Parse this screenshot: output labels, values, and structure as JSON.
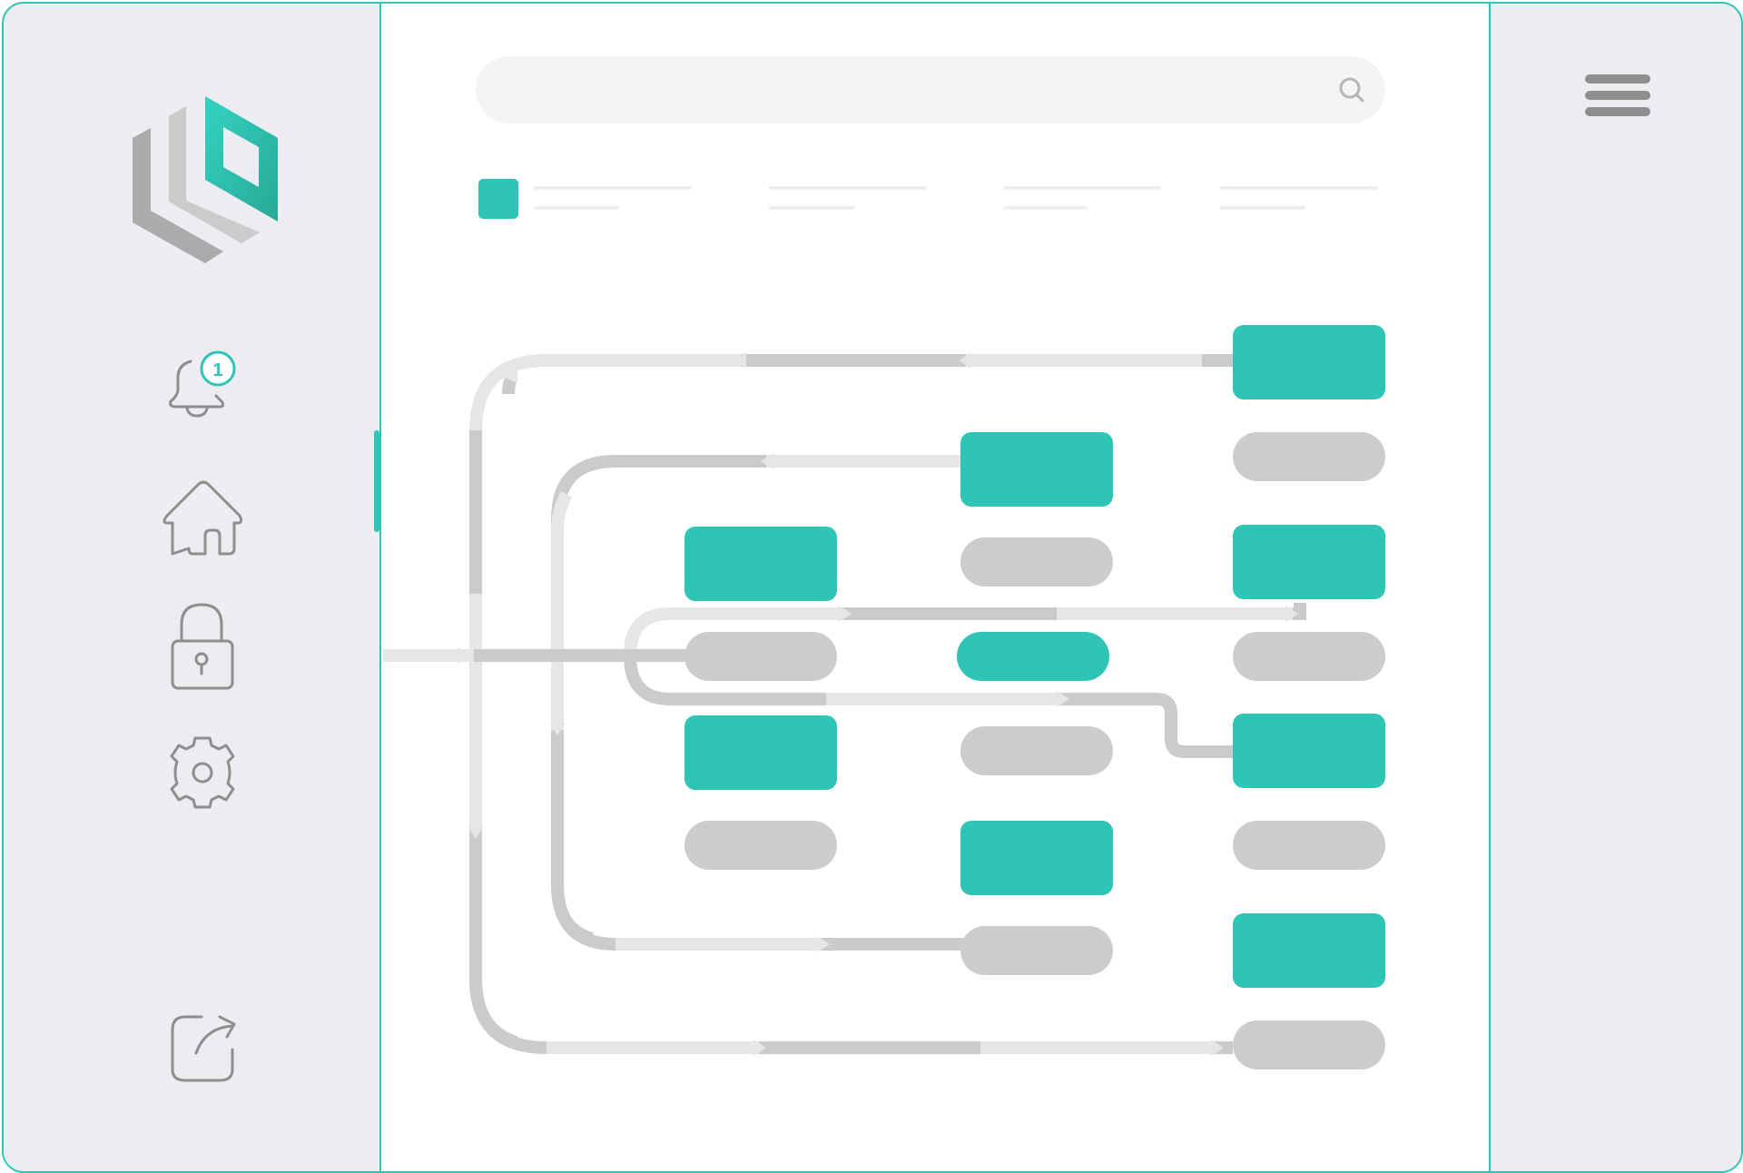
{
  "sidebar": {
    "logo": "brand-logo",
    "notification_count": "1",
    "items": [
      {
        "icon": "bell-icon",
        "name": "notifications"
      },
      {
        "icon": "home-icon",
        "name": "home"
      },
      {
        "icon": "lock-icon",
        "name": "security"
      },
      {
        "icon": "gear-icon",
        "name": "settings"
      },
      {
        "icon": "share-icon",
        "name": "share"
      }
    ]
  },
  "header": {
    "search_placeholder": "",
    "search_icon": "search-icon",
    "menu_icon": "hamburger-menu-icon"
  },
  "colors": {
    "accent": "#2ec4b6",
    "node_inactive": "#cccccc",
    "path_dark": "#cbcbcb",
    "path_light": "#e6e6e6",
    "panel": "#ececf1"
  }
}
